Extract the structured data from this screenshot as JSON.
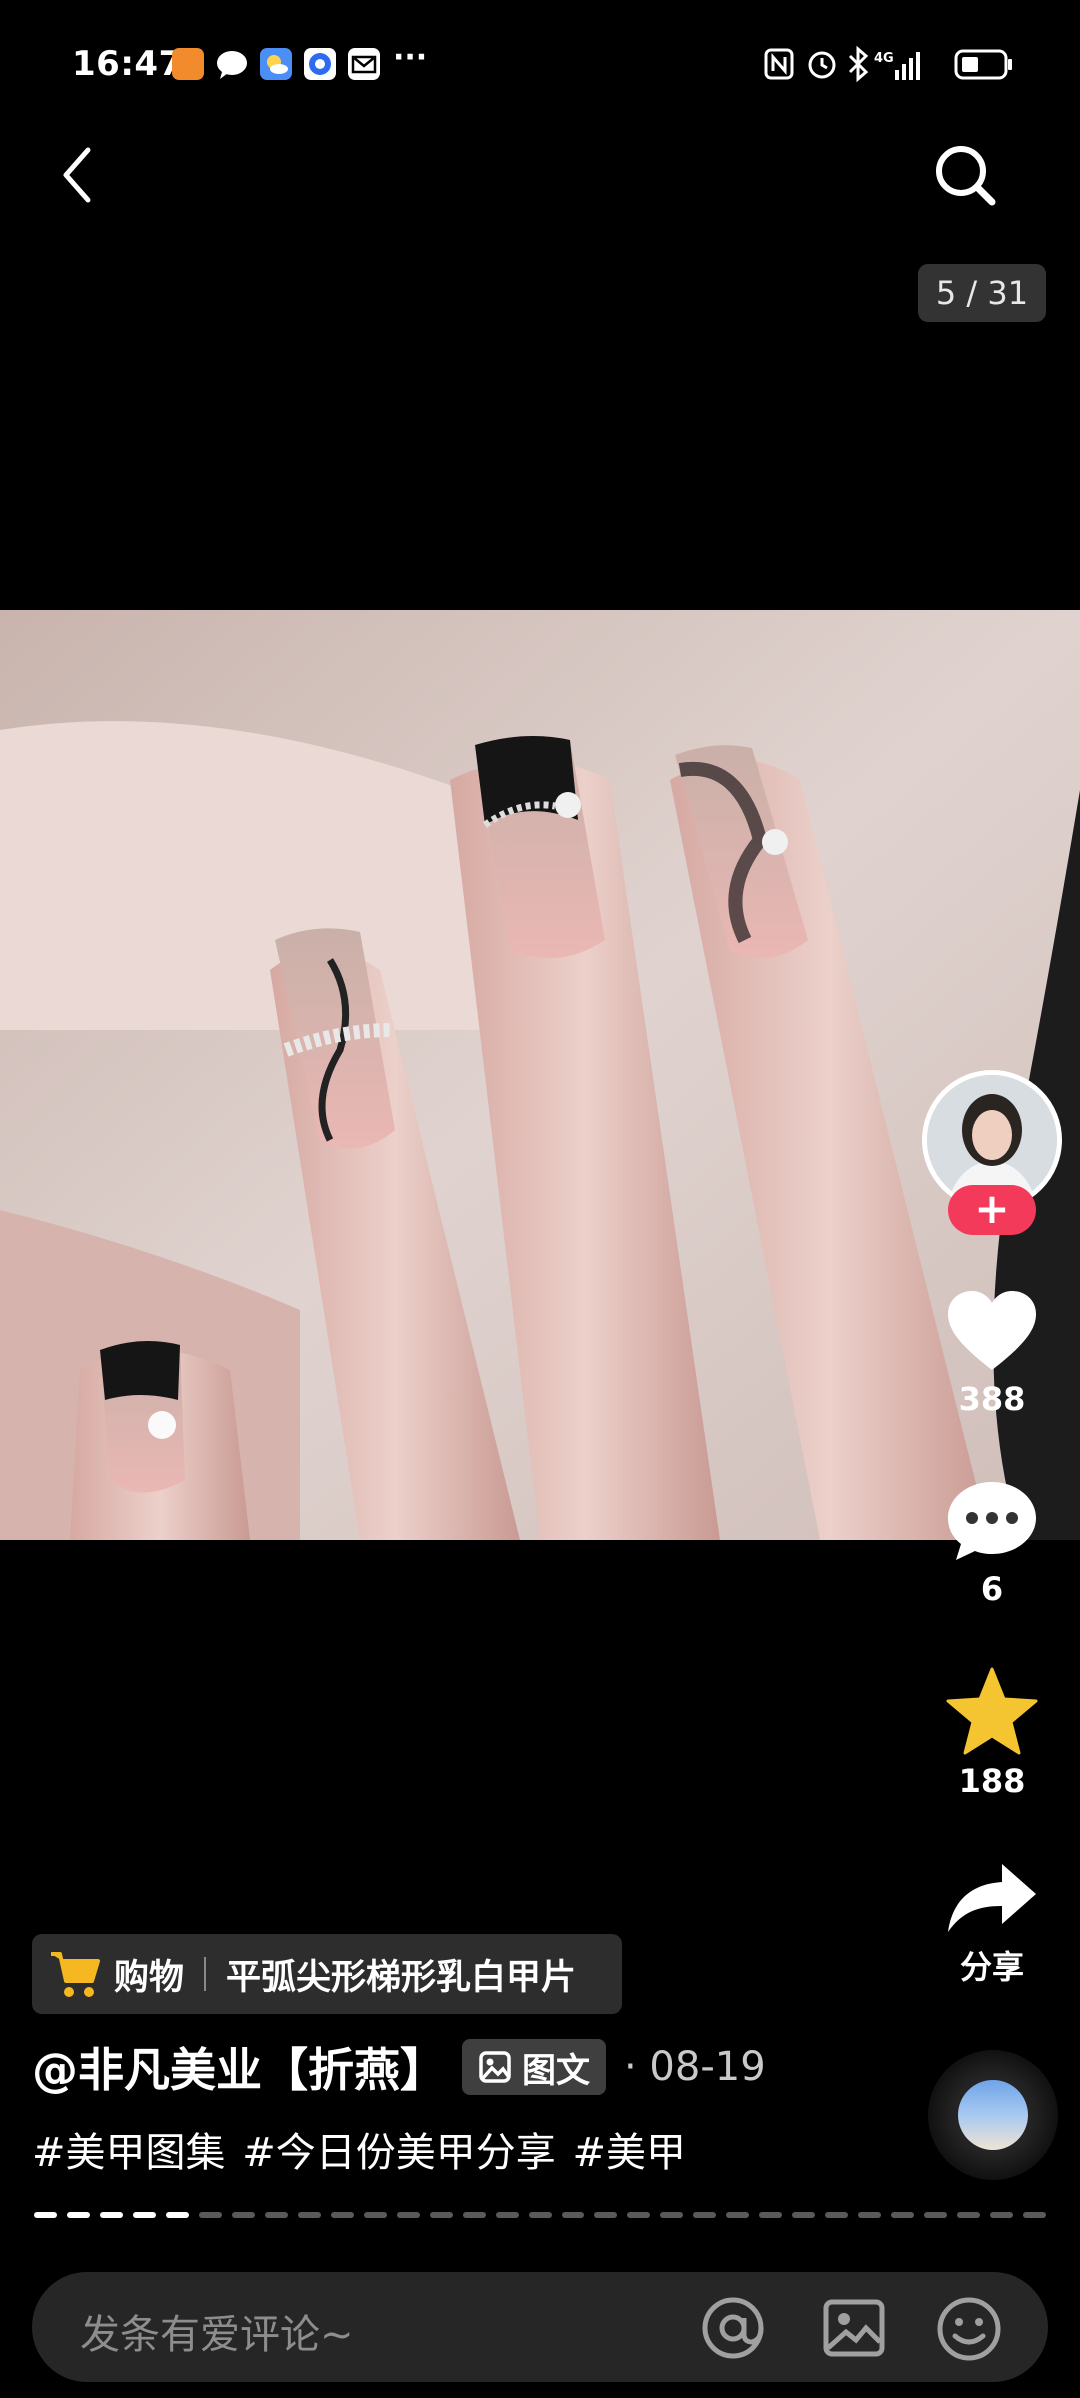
{
  "status": {
    "time": "16:47",
    "more": "···"
  },
  "counter": "5 / 31",
  "actions": {
    "likes": "388",
    "comments": "6",
    "favorites": "188",
    "share_label": "分享",
    "follow_symbol": "+"
  },
  "shop": {
    "label": "购物",
    "product": "平弧尖形梯形乳白甲片"
  },
  "author": "@非凡美业【折燕】",
  "post_type": "图文",
  "date": "· 08-19",
  "tags": "#美甲图集 #今日份美甲分享 #美甲",
  "comment": {
    "placeholder": "发条有爱评论~"
  },
  "colors": {
    "follow": "#f43a5a",
    "favorite": "#f5c431",
    "background": "#000000"
  }
}
